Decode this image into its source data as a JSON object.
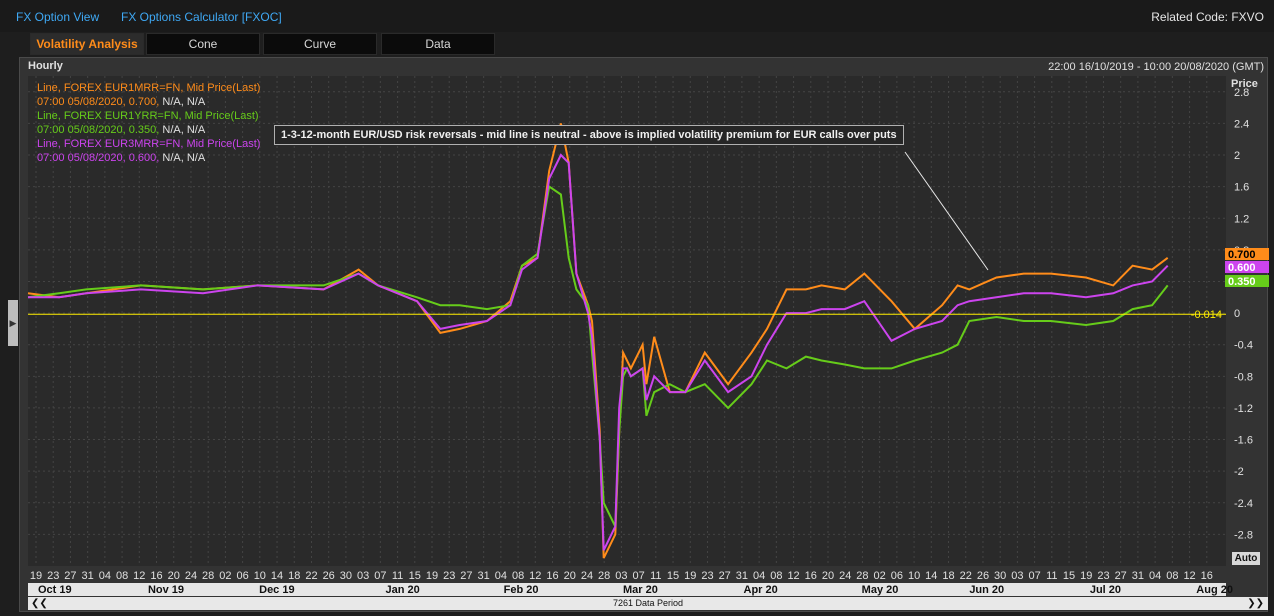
{
  "topbar": {
    "link1": "FX Option View",
    "link2": "FX Options Calculator [FXOC]",
    "related": "Related Code: FXVO"
  },
  "tabs": [
    {
      "label": "Volatility Analysis"
    },
    {
      "label": "Cone"
    },
    {
      "label": "Curve"
    },
    {
      "label": "Data"
    }
  ],
  "panel": {
    "interval": "Hourly",
    "date_range": "22:00 16/10/2019 - 10:00 20/08/2020 (GMT)",
    "price_label": "Price",
    "auto_label": "Auto",
    "data_period": "7261 Data Period",
    "annotation": "1-3-12-month EUR/USD risk reversals - mid line is neutral - above is implied volatility premium for EUR calls over puts"
  },
  "legend": [
    {
      "line1": "Line, FOREX EUR1MRR=FN, Mid Price(Last)",
      "line2a": "07:00 05/08/2020, 0.700,",
      "line2b": " N/A, N/A",
      "color": "#ff8c1a"
    },
    {
      "line1": "Line, FOREX EUR1YRR=FN, Mid Price(Last)",
      "line2a": "07:00 05/08/2020, 0.350,",
      "line2b": " N/A, N/A",
      "color": "#66cc1a"
    },
    {
      "line1": "Line, FOREX EUR3MRR=FN, Mid Price(Last)",
      "line2a": "07:00 05/08/2020, 0.600,",
      "line2b": " N/A, N/A",
      "color": "#cc44ee"
    }
  ],
  "chart_data": {
    "type": "line",
    "ylabel": "Price",
    "ylim": [
      -3.2,
      3.0
    ],
    "y_ticks": [
      "2.8",
      "2.4",
      "2",
      "1.6",
      "1.2",
      "0.8",
      "0.4",
      "0",
      "-0.4",
      "-0.8",
      "-1.2",
      "-1.6",
      "-2",
      "-2.4",
      "-2.8"
    ],
    "y_tick_values": [
      2.8,
      2.4,
      2,
      1.6,
      1.2,
      0.8,
      0.4,
      0,
      -0.4,
      -0.8,
      -1.2,
      -1.6,
      -2,
      -2.4,
      -2.8
    ],
    "reference_line": {
      "value": -0.014,
      "label": "-0.014",
      "color": "#ffee00"
    },
    "x_day_ticks": [
      "19",
      "23",
      "27",
      "31",
      "04",
      "08",
      "12",
      "16",
      "20",
      "24",
      "28",
      "02",
      "06",
      "10",
      "14",
      "18",
      "22",
      "26",
      "30",
      "03",
      "07",
      "11",
      "15",
      "19",
      "23",
      "27",
      "31",
      "04",
      "08",
      "12",
      "16",
      "20",
      "24",
      "28",
      "03",
      "07",
      "11",
      "15",
      "19",
      "23",
      "27",
      "31",
      "04",
      "08",
      "12",
      "16",
      "20",
      "24",
      "28",
      "02",
      "06",
      "10",
      "14",
      "18",
      "22",
      "26",
      "30",
      "03",
      "07",
      "11",
      "15",
      "19",
      "23",
      "27",
      "31",
      "04",
      "08",
      "12",
      "16"
    ],
    "x_months": [
      {
        "label": "Oct 19",
        "pos": 0.0
      },
      {
        "label": "Nov 19",
        "pos": 0.094
      },
      {
        "label": "Dec 19",
        "pos": 0.189
      },
      {
        "label": "Jan 20",
        "pos": 0.297
      },
      {
        "label": "Feb 20",
        "pos": 0.398
      },
      {
        "label": "Mar 20",
        "pos": 0.5
      },
      {
        "label": "Apr 20",
        "pos": 0.603
      },
      {
        "label": "May 20",
        "pos": 0.704
      },
      {
        "label": "Jun 20",
        "pos": 0.796
      },
      {
        "label": "Jul 20",
        "pos": 0.899
      },
      {
        "label": "Aug 20",
        "pos": 0.99
      }
    ],
    "grid": true,
    "x": [
      "2019-10-17",
      "2019-10-25",
      "2019-11-01",
      "2019-11-15",
      "2019-12-01",
      "2019-12-15",
      "2020-01-01",
      "2020-01-10",
      "2020-01-15",
      "2020-01-25",
      "2020-01-31",
      "2020-02-05",
      "2020-02-12",
      "2020-02-18",
      "2020-02-21",
      "2020-02-25",
      "2020-02-28",
      "2020-03-02",
      "2020-03-04",
      "2020-03-06",
      "2020-03-09",
      "2020-03-10",
      "2020-03-12",
      "2020-03-13",
      "2020-03-16",
      "2020-03-17",
      "2020-03-18",
      "2020-03-19",
      "2020-03-20",
      "2020-03-23",
      "2020-03-24",
      "2020-03-26",
      "2020-03-30",
      "2020-04-03",
      "2020-04-08",
      "2020-04-14",
      "2020-04-20",
      "2020-04-24",
      "2020-04-29",
      "2020-05-04",
      "2020-05-08",
      "2020-05-14",
      "2020-05-19",
      "2020-05-26",
      "2020-06-01",
      "2020-06-08",
      "2020-06-12",
      "2020-06-15",
      "2020-06-22",
      "2020-06-29",
      "2020-07-06",
      "2020-07-15",
      "2020-07-22",
      "2020-07-27",
      "2020-08-01",
      "2020-08-05"
    ],
    "series": [
      {
        "name": "FOREX EUR1MRR=FN",
        "color": "#ff8c1a",
        "values": [
          0.25,
          0.2,
          0.25,
          0.35,
          0.3,
          0.35,
          0.3,
          0.55,
          0.35,
          0.15,
          -0.25,
          -0.2,
          -0.1,
          0.15,
          0.6,
          0.7,
          1.8,
          2.4,
          1.9,
          0.5,
          0.1,
          -0.1,
          -1.5,
          -3.1,
          -2.8,
          -1.5,
          -0.5,
          -0.6,
          -0.7,
          -0.4,
          -0.9,
          -0.3,
          -1.0,
          -1.0,
          -0.5,
          -0.9,
          -0.5,
          -0.2,
          0.3,
          0.3,
          0.35,
          0.3,
          0.5,
          0.15,
          -0.2,
          0.1,
          0.35,
          0.3,
          0.45,
          0.5,
          0.5,
          0.45,
          0.35,
          0.6,
          0.55,
          0.7
        ]
      },
      {
        "name": "FOREX EUR1YRR=FN",
        "color": "#66cc1a",
        "values": [
          0.2,
          0.25,
          0.3,
          0.35,
          0.3,
          0.35,
          0.35,
          0.5,
          0.35,
          0.2,
          0.1,
          0.1,
          0.05,
          0.1,
          0.6,
          0.75,
          1.6,
          1.5,
          0.7,
          0.3,
          0.1,
          -0.5,
          -1.6,
          -2.4,
          -2.7,
          -1.5,
          -0.8,
          -0.7,
          -0.8,
          -0.7,
          -1.3,
          -1.0,
          -0.9,
          -1.0,
          -0.9,
          -1.2,
          -0.9,
          -0.6,
          -0.7,
          -0.55,
          -0.6,
          -0.65,
          -0.7,
          -0.7,
          -0.6,
          -0.5,
          -0.4,
          -0.1,
          -0.05,
          -0.1,
          -0.1,
          -0.15,
          -0.1,
          0.05,
          0.1,
          0.35
        ]
      },
      {
        "name": "FOREX EUR3MRR=FN",
        "color": "#cc44ee",
        "values": [
          0.2,
          0.2,
          0.25,
          0.3,
          0.25,
          0.35,
          0.3,
          0.5,
          0.35,
          0.15,
          -0.2,
          -0.15,
          -0.1,
          0.1,
          0.55,
          0.7,
          1.7,
          2.0,
          1.9,
          0.5,
          0.0,
          -0.3,
          -1.6,
          -3.0,
          -2.7,
          -1.2,
          -0.7,
          -0.7,
          -0.8,
          -0.7,
          -1.1,
          -0.8,
          -1.0,
          -1.0,
          -0.6,
          -1.0,
          -0.8,
          -0.4,
          0.0,
          0.0,
          0.05,
          0.05,
          0.15,
          -0.35,
          -0.2,
          -0.1,
          0.1,
          0.15,
          0.2,
          0.25,
          0.25,
          0.2,
          0.25,
          0.35,
          0.4,
          0.6
        ]
      }
    ]
  }
}
